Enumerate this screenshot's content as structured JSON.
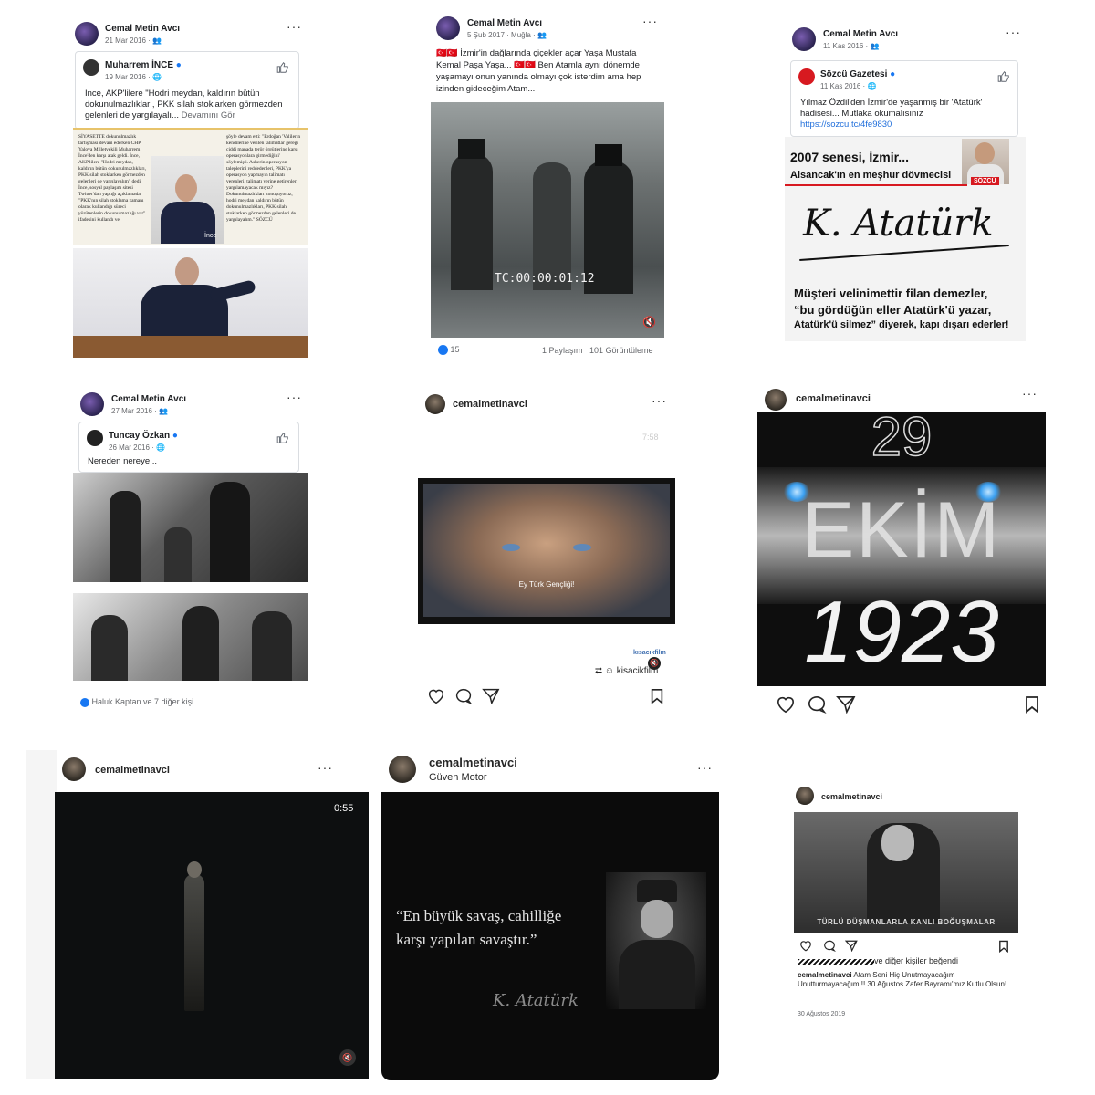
{
  "post1": {
    "author": "Cemal Metin Avcı",
    "date": "21 Mar 2016 · ",
    "shared_author": "Muharrem İNCE",
    "shared_date": "19 Mar 2016 · ",
    "text": "İnce, AKP'lilere \"Hodri meydan, kaldırın bütün dokunulmazlıkları, PKK silah stoklarken görmezden gelenleri de yargılayalı...",
    "see_more": "Devamını Gör",
    "clip_col1": "SİYASETTE dokunulmazlık tartışması devam ederken CHP Yalova Milletvekili Muharrem İnce'den karşı atak geldi. İnce, AKP'lilere \"Hodri meydan, kaldırın bütün dokunulmazlıkları, PKK silah stoklarken görmezden gelenleri de yargılayalım\" dedi. İnce, sosyal paylaşım sitesi Twitter'dan yaptığı açıklamada, \"PKK'nın silah stoklama zamanı olarak kullandığı süreci yürütenlerin dokunulmazlığı var\" ifadesini kullandı ve",
    "clip_col2": "şöyle devam etti: \"Erdoğan 'Valilerin kendilerine verilen talimatlar gereği ciddi manada terör örgütlerine karşı operasyonlara girmediğini' söylemişti. Askerin operasyon taleplerini reddedenleri, PKK'ya operasyon yapmayın talimatı verenleri, talimatı yerine getirenleri yargılamayacak mıyız? Dokunulmazlıkları konuşuyoruz, hodri meydan kaldırın bütün dokunulmazlıkları, PKK silah stoklarken görmezden gelenleri de yargılayalım.\" SÖZCÜ",
    "clip_caption": "İnce"
  },
  "post2": {
    "author": "Cemal Metin Avcı",
    "date": "5 Şub 2017 · Muğla · ",
    "text": "🇹🇷🇹🇷 İzmir'in dağlarında çiçekler açar Yaşa Mustafa Kemal Paşa Yaşa... 🇹🇷🇹🇷 Ben Atamla aynı dönemde yaşamayı onun yanında olmayı çok isterdim ama hep izinden gideceğim Atam...",
    "timecode": "TC:00:00:01:12",
    "likes": "15",
    "shares": "1 Paylaşım",
    "views": "101 Görüntüleme"
  },
  "post3": {
    "author": "Cemal Metin Avcı",
    "date": "11 Kas 2016 · ",
    "shared_author": "Sözcü Gazetesi",
    "shared_date": "11 Kas 2016 · ",
    "text": "Yılmaz Özdil'den İzmir'de yaşanmış bir 'Atatürk' hadisesi... Mutlaka okumalısınız",
    "link": "https://sozcu.tc/4fe9830",
    "headline1": "2007 senesi, İzmir...",
    "headline2": "Alsancak'ın en meşhur dövmecisi",
    "brand": "SÖZCÜ",
    "signature": "K. Atatürk",
    "quote1": "Müşteri velinimettir filan demezler,",
    "quote2": "“bu gördüğün eller Atatürk'ü yazar,",
    "quote3": "Atatürk'ü silmez” diyerek, kapı dışarı ederler!"
  },
  "post4": {
    "author": "Cemal Metin Avcı",
    "date": "27 Mar 2016 · ",
    "shared_author": "Tuncay Özkan",
    "shared_date": "26 Mar 2016 · ",
    "text": "Nereden nereye...",
    "reactions": "Haluk Kaptan ve 7 diğer kişi"
  },
  "post5": {
    "username": "cemalmetinavci",
    "duration": "7:58",
    "subtitle": "Ey Türk Gençliği!",
    "watermark": "kısacıkfilm",
    "repost_user": "kisacikfilm"
  },
  "post6": {
    "username": "cemalmetinavci",
    "line1": "29",
    "line2": "EKİM",
    "line3": "1923"
  },
  "post7": {
    "username": "cemalmetinavci",
    "duration": "0:55"
  },
  "post8": {
    "username": "cemalmetinavci",
    "location": "Güven Motor",
    "quote1": "“En büyük savaş, cahilliğe",
    "quote2": "karşı yapılan savaştır.”",
    "signature": "K. Atatürk"
  },
  "post9": {
    "username": "cemalmetinavci",
    "image_caption": "TÜRLÜ DÜŞMANLARLA KANLI BOĞUŞMALAR",
    "likes_text": "ve diğer kişiler beğendi",
    "caption_user": "cemalmetinavci",
    "caption": " Atam Seni Hiç Unutmayacağım Unutturmayacağım !! 30 Ağustos Zafer Bayramı'mız Kutlu Olsun!",
    "date": "30 Ağustos 2019"
  },
  "ui": {
    "more": "···"
  }
}
